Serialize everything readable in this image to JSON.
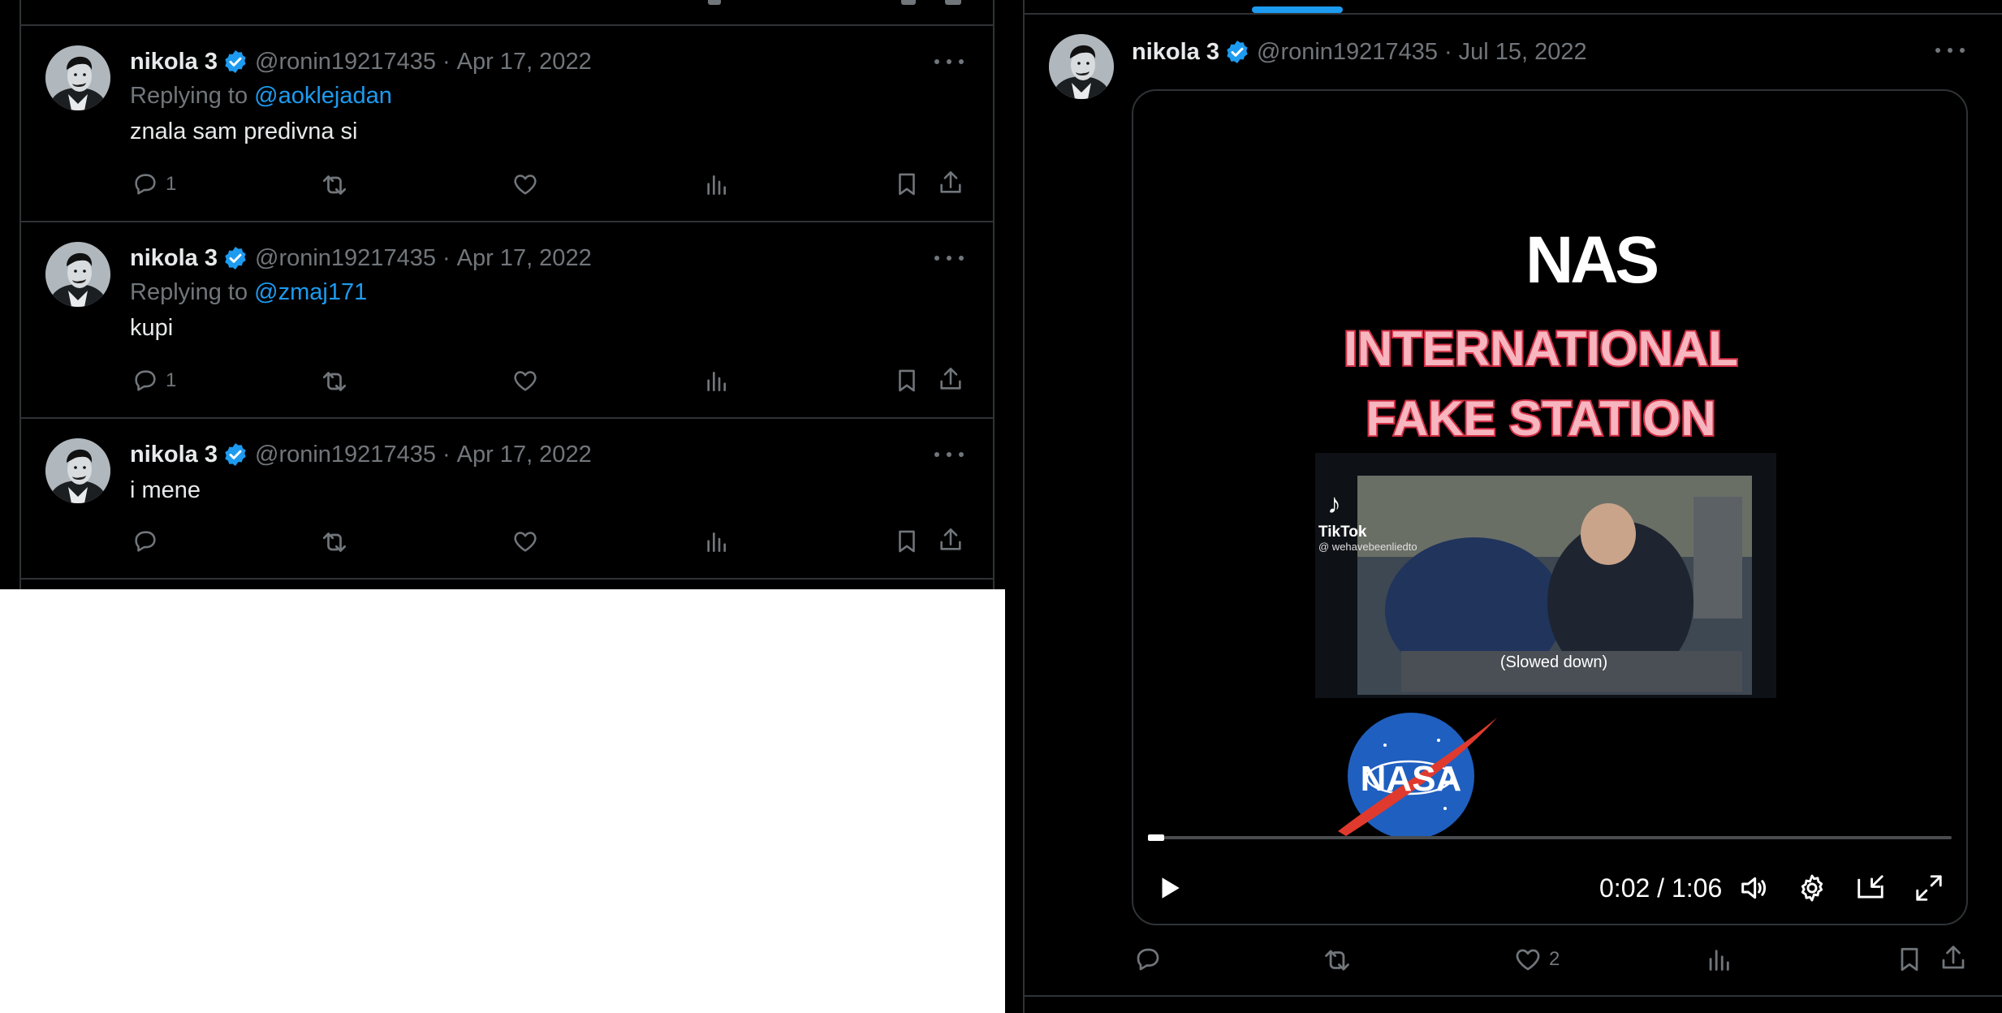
{
  "left_thread": {
    "tweets": [
      {
        "name": "nikola 3",
        "handle": "@ronin19217435",
        "separator": "·",
        "date": "Apr 17, 2022",
        "reply_prefix": "Replying to",
        "reply_to": "@aoklejadan",
        "text": "znala sam predivna si",
        "reply_count": "1"
      },
      {
        "name": "nikola 3",
        "handle": "@ronin19217435",
        "separator": "·",
        "date": "Apr 17, 2022",
        "reply_prefix": "Replying to",
        "reply_to": "@zmaj171",
        "text": "kupi",
        "reply_count": "1"
      },
      {
        "name": "nikola 3",
        "handle": "@ronin19217435",
        "separator": "·",
        "date": "Apr 17, 2022",
        "text": "i mene"
      }
    ]
  },
  "right_tweet": {
    "name": "nikola 3",
    "handle": "@ronin19217435",
    "separator": "·",
    "date": "Jul 15, 2022",
    "like_count": "2",
    "video": {
      "logo_text": "NAS",
      "title_line1": "INTERNATIONAL",
      "title_line2": "FAKE STATION",
      "tiktok_label": "TikTok",
      "tiktok_handle": "@ wehavebeenliedto",
      "caption": "(Slowed down)",
      "nasa_text": "NASA",
      "time": "0:02 / 1:06",
      "progress": 0.02
    }
  },
  "icons": [
    "reply-icon",
    "retweet-icon",
    "like-icon",
    "views-icon",
    "bookmark-icon",
    "share-icon",
    "verified-badge-icon",
    "more-icon",
    "play-icon",
    "volume-icon",
    "settings-icon",
    "pip-icon",
    "fullscreen-icon"
  ],
  "colors": {
    "background": "#000000",
    "accent": "#1d9bf0",
    "muted": "#71767b",
    "border": "#2f3336",
    "text": "#e7e9ea"
  }
}
